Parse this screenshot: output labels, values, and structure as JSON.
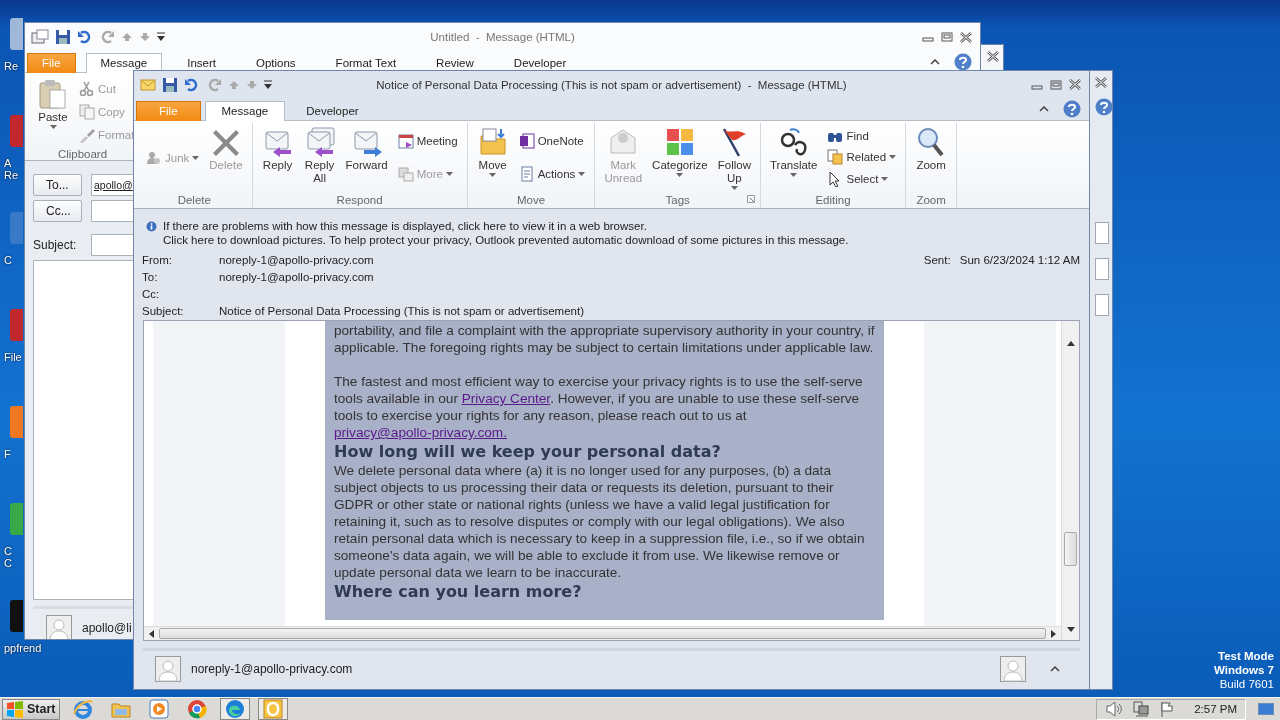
{
  "desktop": {
    "icons": [
      {
        "lines": [
          "Re"
        ],
        "color": "#9fb8d8"
      },
      {
        "lines": [
          "A",
          "Re"
        ],
        "color": "#c0282d"
      },
      {
        "lines": [
          "C"
        ],
        "color": "#3a78c8"
      },
      {
        "lines": [
          "File"
        ],
        "color": "#c0282d"
      },
      {
        "lines": [
          "F"
        ],
        "color": "#f07820"
      },
      {
        "lines": [
          "C",
          "C"
        ],
        "color": "#38a848"
      },
      {
        "lines": [
          "ppfrend"
        ],
        "color": "#111111"
      }
    ],
    "notice": [
      "Test Mode",
      "Windows 7",
      "Build 7601"
    ]
  },
  "back_window": {
    "title": "Untitled  -  Message (HTML)",
    "tabs": [
      {
        "label": "File",
        "kind": "file",
        "selected": false
      },
      {
        "label": "Message",
        "kind": "tab",
        "selected": true
      },
      {
        "label": "Insert",
        "kind": "tab",
        "selected": false
      },
      {
        "label": "Options",
        "kind": "tab",
        "selected": false
      },
      {
        "label": "Format Text",
        "kind": "tab",
        "selected": false
      },
      {
        "label": "Review",
        "kind": "tab",
        "selected": false
      },
      {
        "label": "Developer",
        "kind": "tab",
        "selected": false
      }
    ],
    "clipboard": {
      "label": "Clipboard",
      "paste": "Paste",
      "tools": [
        {
          "kind": "cut",
          "label": "Cut",
          "disabled": true
        },
        {
          "kind": "copy",
          "label": "Copy",
          "disabled": true
        },
        {
          "kind": "format",
          "label": "Format",
          "disabled": true
        }
      ]
    },
    "address": [
      {
        "kind": "button",
        "label": "To...",
        "value": "apollo@"
      },
      {
        "kind": "button",
        "label": "Cc..."
      },
      {
        "kind": "label",
        "label": "Subject:"
      }
    ],
    "contact": "apollo@li"
  },
  "message_window": {
    "title": "Notice of Personal Data Processing (This is not spam or advertisement)  -  Message (HTML)",
    "tabs": [
      {
        "label": "File",
        "kind": "file",
        "selected": false
      },
      {
        "label": "Message",
        "kind": "tab",
        "selected": true
      },
      {
        "label": "Developer",
        "kind": "tab",
        "selected": false
      }
    ],
    "ribbon": [
      {
        "label": "Delete",
        "columns": [
          {
            "kind": "small",
            "buttons": [
              {
                "kind": "junk",
                "label": "Junk",
                "disabled": true,
                "dropdown": true
              }
            ]
          },
          {
            "kind": "large",
            "buttons": [
              {
                "kind": "delete",
                "label": "Delete",
                "disabled": true,
                "dropdown": false
              }
            ]
          }
        ]
      },
      {
        "label": "Respond",
        "columns": [
          {
            "kind": "large",
            "buttons": [
              {
                "kind": "reply",
                "label": "Reply",
                "disabled": false,
                "dropdown": false
              }
            ]
          },
          {
            "kind": "large",
            "buttons": [
              {
                "kind": "reply_all",
                "label": "Reply All",
                "disabled": false,
                "dropdown": false
              }
            ]
          },
          {
            "kind": "large",
            "buttons": [
              {
                "kind": "forward",
                "label": "Forward",
                "disabled": false,
                "dropdown": false
              }
            ]
          },
          {
            "kind": "small",
            "buttons": [
              {
                "kind": "meeting",
                "label": "Meeting",
                "disabled": false,
                "dropdown": false
              },
              {
                "kind": "more",
                "label": "More",
                "disabled": true,
                "dropdown": true
              }
            ]
          }
        ]
      },
      {
        "label": "Move",
        "columns": [
          {
            "kind": "large",
            "buttons": [
              {
                "kind": "move",
                "label": "Move",
                "disabled": false,
                "dropdown": true
              }
            ]
          },
          {
            "kind": "small",
            "buttons": [
              {
                "kind": "onenote",
                "label": "OneNote",
                "disabled": false,
                "dropdown": false
              },
              {
                "kind": "actions",
                "label": "Actions",
                "disabled": false,
                "dropdown": true
              }
            ]
          }
        ]
      },
      {
        "label": "Tags",
        "launcher": true,
        "columns": [
          {
            "kind": "large",
            "buttons": [
              {
                "kind": "mark_unread",
                "label": "Mark Unread",
                "disabled": true,
                "dropdown": false
              }
            ]
          },
          {
            "kind": "large",
            "buttons": [
              {
                "kind": "categorize",
                "label": "Categorize",
                "disabled": false,
                "dropdown": true
              }
            ]
          },
          {
            "kind": "large",
            "buttons": [
              {
                "kind": "follow_up",
                "label": "Follow Up",
                "disabled": false,
                "dropdown": true
              }
            ]
          }
        ]
      },
      {
        "label": "Editing",
        "columns": [
          {
            "kind": "large",
            "buttons": [
              {
                "kind": "translate",
                "label": "Translate",
                "disabled": false,
                "dropdown": true
              }
            ]
          },
          {
            "kind": "small",
            "buttons": [
              {
                "kind": "find",
                "label": "Find",
                "disabled": false,
                "dropdown": false
              },
              {
                "kind": "related",
                "label": "Related",
                "disabled": false,
                "dropdown": true
              },
              {
                "kind": "select",
                "label": "Select",
                "disabled": false,
                "dropdown": true
              }
            ]
          }
        ]
      },
      {
        "label": "Zoom",
        "columns": [
          {
            "kind": "large",
            "buttons": [
              {
                "kind": "zoom",
                "label": "Zoom",
                "disabled": false,
                "dropdown": false
              }
            ]
          }
        ]
      }
    ],
    "infobar": [
      "If there are problems with how this message is displayed, click here to view it in a web browser.",
      "Click here to download pictures. To help protect your privacy, Outlook prevented automatic download of some pictures in this message."
    ],
    "headers": [
      {
        "label": "From:",
        "value": "noreply-1@apollo-privacy.com"
      },
      {
        "label": "To:",
        "value": "noreply-1@apollo-privacy.com"
      },
      {
        "label": "Cc:"
      },
      {
        "label": "Subject:",
        "value": "Notice of Personal Data Processing (This is not spam or advertisement)"
      }
    ],
    "sent": {
      "label": "Sent:",
      "value": "Sun 6/23/2024 1:12 AM"
    },
    "body": [
      {
        "kind": "paragraph",
        "parts": [
          {
            "kind": "text",
            "text": "portability, and file a complaint with the appropriate supervisory authority in your country, if applicable. The foregoing rights may be subject to certain limitations under applicable law."
          }
        ]
      },
      {
        "kind": "paragraph",
        "parts": [
          {
            "kind": "text",
            "text": "The fastest and most efficient way to exercise your privacy rights is to use the self-serve tools available in our "
          },
          {
            "kind": "link",
            "text": "Privacy Center"
          },
          {
            "kind": "text",
            "text": ". However, if you are unable to use these self-serve tools to exercise your rights for any reason, please reach out to us at "
          },
          {
            "kind": "link",
            "text": "privacy@apollo-privacy.com."
          }
        ]
      },
      {
        "kind": "heading",
        "text": "How long will we keep your personal data?"
      },
      {
        "kind": "paragraph",
        "parts": [
          {
            "kind": "text",
            "text": "We delete personal data where (a) it is no longer used for any purposes, (b) a data subject objects to us processing their data or requests its deletion, pursuant to their GDPR or other state or national rights (unless we have a valid legal justification for retaining it, such as to resolve disputes or comply with our legal obligations). We also retain personal data which is necessary to keep in a suppression file, i.e., so if we obtain someone's data again, we will be able to exclude it from use. We likewise remove or update personal data we learn to be inaccurate."
          }
        ]
      },
      {
        "kind": "heading",
        "text": "Where can you learn more?"
      }
    ],
    "contact": "noreply-1@apollo-privacy.com"
  },
  "taskbar": {
    "start": "Start",
    "apps": [
      {
        "kind": "ie",
        "running": false
      },
      {
        "kind": "explorer",
        "running": false
      },
      {
        "kind": "media",
        "running": false
      },
      {
        "kind": "chrome",
        "running": false
      },
      {
        "kind": "edge",
        "running": true
      },
      {
        "kind": "outlook",
        "running": true
      }
    ],
    "clock": "2:57 PM"
  }
}
